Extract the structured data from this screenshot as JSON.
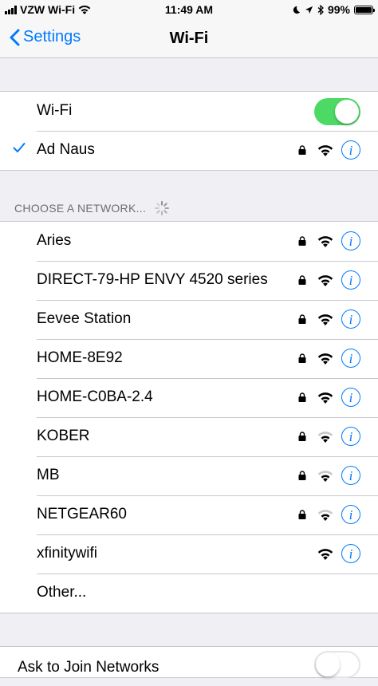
{
  "status_bar": {
    "carrier": "VZW Wi-Fi",
    "time": "11:49 AM",
    "battery": "99%",
    "battery_level": 0.99
  },
  "nav": {
    "back_label": "Settings",
    "title": "Wi-Fi"
  },
  "wifi_toggle": {
    "label": "Wi-Fi",
    "on": true
  },
  "connected": {
    "name": "Ad Naus",
    "secured": true,
    "signal": 3
  },
  "section_header": "CHOOSE A NETWORK...",
  "networks": [
    {
      "name": "Aries",
      "secured": true,
      "signal": 3
    },
    {
      "name": "DIRECT-79-HP ENVY 4520 series",
      "secured": true,
      "signal": 3
    },
    {
      "name": "Eevee Station",
      "secured": true,
      "signal": 3
    },
    {
      "name": "HOME-8E92",
      "secured": true,
      "signal": 3
    },
    {
      "name": "HOME-C0BA-2.4",
      "secured": true,
      "signal": 3
    },
    {
      "name": "KOBER",
      "secured": true,
      "signal": 2
    },
    {
      "name": "MB",
      "secured": true,
      "signal": 2
    },
    {
      "name": "NETGEAR60",
      "secured": true,
      "signal": 2
    },
    {
      "name": "xfinitywifi",
      "secured": false,
      "signal": 3
    }
  ],
  "other_label": "Other...",
  "ask_to_join": {
    "label": "Ask to Join Networks",
    "on": false
  },
  "colors": {
    "accent": "#007aff",
    "toggle_on": "#4cd964",
    "background": "#efeff4"
  }
}
